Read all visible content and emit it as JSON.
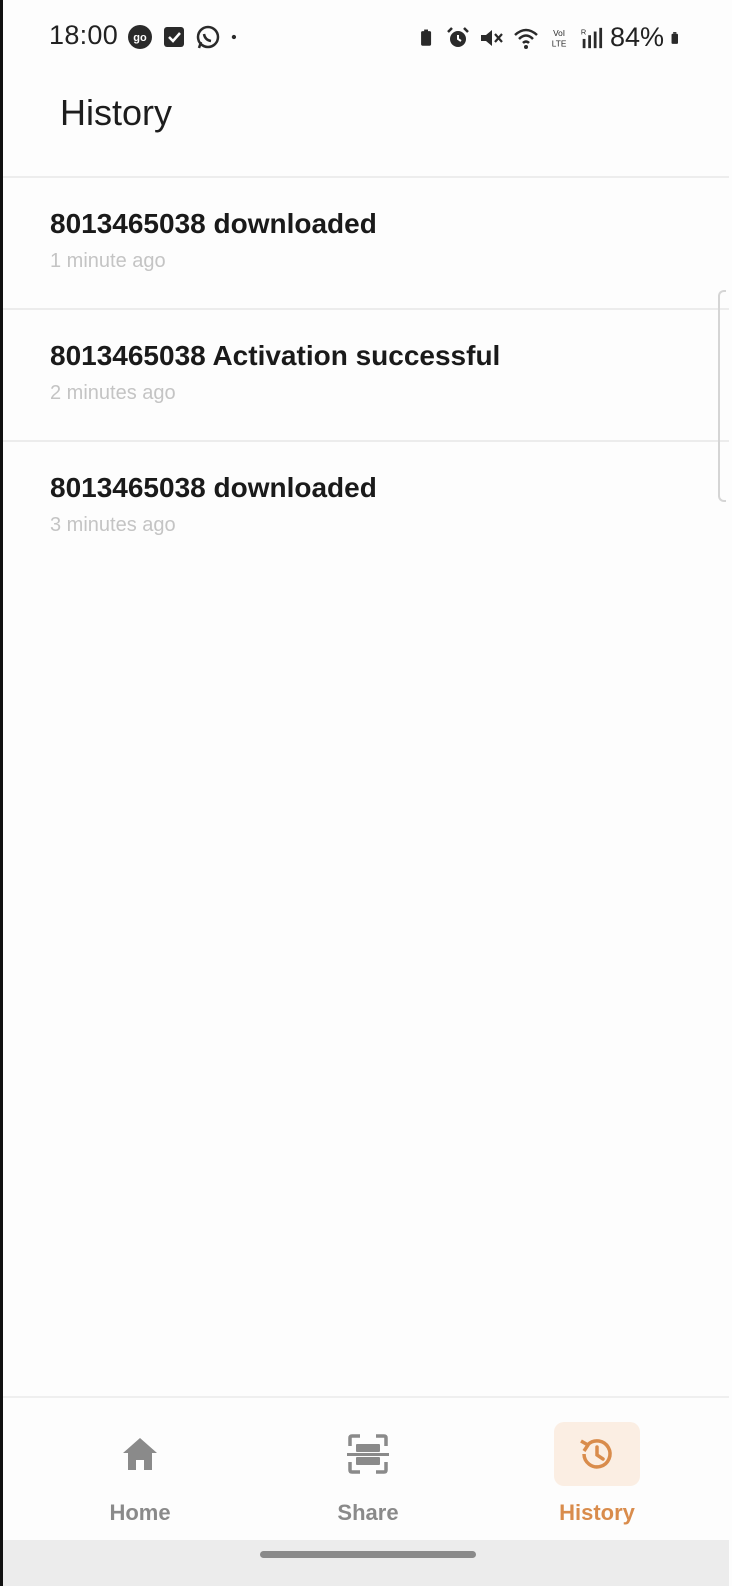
{
  "status_bar": {
    "time": "18:00",
    "battery": "84%",
    "left_icons": [
      "go-badge-icon",
      "check-square-icon",
      "whatsapp-icon",
      "dot-icon"
    ],
    "right_icons": [
      "battery-saver-icon",
      "alarm-icon",
      "mute-icon",
      "wifi-icon",
      "volte-icon",
      "signal-icon",
      "battery-icon"
    ]
  },
  "header": {
    "title": "History"
  },
  "history": [
    {
      "title": "8013465038 downloaded",
      "time": "1 minute ago"
    },
    {
      "title": "8013465038 Activation successful",
      "time": "2 minutes ago"
    },
    {
      "title": "8013465038 downloaded",
      "time": "3 minutes ago"
    }
  ],
  "bottom_nav": {
    "items": [
      {
        "label": "Home",
        "icon": "home-icon",
        "active": false
      },
      {
        "label": "Share",
        "icon": "scan-icon",
        "active": false
      },
      {
        "label": "History",
        "icon": "history-icon",
        "active": true
      }
    ],
    "active_color": "#d98c4c",
    "inactive_color": "#8a8a8a"
  }
}
